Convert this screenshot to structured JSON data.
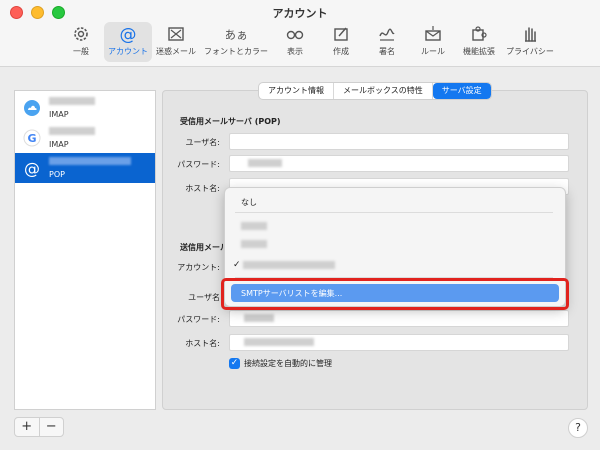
{
  "window": {
    "title": "アカウント"
  },
  "toolbar": [
    {
      "label": "一般",
      "icon": "gear-icon"
    },
    {
      "label": "アカウント",
      "icon": "at-icon",
      "selected": true
    },
    {
      "label": "迷惑メール",
      "icon": "junk-icon"
    },
    {
      "label": "フォントとカラー",
      "icon": "font-icon"
    },
    {
      "label": "表示",
      "icon": "glasses-icon"
    },
    {
      "label": "作成",
      "icon": "compose-icon"
    },
    {
      "label": "署名",
      "icon": "signature-icon"
    },
    {
      "label": "ルール",
      "icon": "rules-icon"
    },
    {
      "label": "機能拡張",
      "icon": "extension-icon"
    },
    {
      "label": "プライバシー",
      "icon": "hand-icon"
    }
  ],
  "accounts": [
    {
      "type": "IMAP",
      "icon": "icloud-icon"
    },
    {
      "type": "IMAP",
      "icon": "google-icon"
    },
    {
      "type": "POP",
      "icon": "at-icon",
      "selected": true
    }
  ],
  "tabs": [
    {
      "label": "アカウント情報"
    },
    {
      "label": "メールボックスの特性"
    },
    {
      "label": "サーバ設定",
      "selected": true
    }
  ],
  "incoming": {
    "title": "受信用メールサーバ (POP)",
    "username_label": "ユーザ名:",
    "password_label": "パスワード:",
    "host_label": "ホスト名:"
  },
  "outgoing": {
    "title": "送信用メール",
    "account_label": "アカウント:",
    "username_label": "ユーザ名",
    "password_label": "パスワード:",
    "host_label": "ホスト名:",
    "auto_manage_label": "接続設定を自動的に管理",
    "auto_manage_checked": true
  },
  "menu": {
    "none_label": "なし",
    "checkmark": "✓",
    "edit_smtp_label": "SMTPサーバリストを編集..."
  },
  "controls": {
    "add": "+",
    "remove": "−",
    "help": "?"
  },
  "colors": {
    "accent": "#1478f0",
    "selection": "#0a64d0",
    "callout": "#e1231e"
  }
}
